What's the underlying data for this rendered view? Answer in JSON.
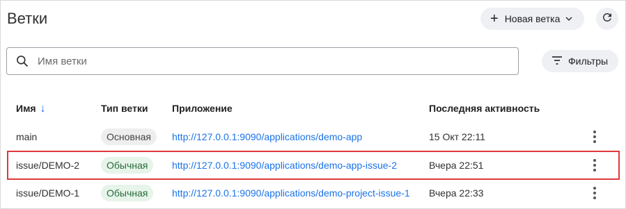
{
  "header": {
    "title": "Ветки",
    "new_branch_label": "Новая ветка",
    "new_branch_icon": "plus-icon",
    "refresh_icon": "refresh-icon"
  },
  "search": {
    "placeholder": "Имя ветки",
    "value": "",
    "icon": "search-icon"
  },
  "filters": {
    "label": "Фильтры",
    "icon": "filter-icon"
  },
  "table": {
    "columns": [
      "Имя",
      "Тип ветки",
      "Приложение",
      "Последняя активность"
    ],
    "sort_indicator": "↓",
    "rows": [
      {
        "name": "main",
        "type": "Основная",
        "app": "http://127.0.0.1:9090/applications/demo-app",
        "activity": "15 Окт 22:11"
      },
      {
        "name": "issue/DEMO-2",
        "type": "Обычная",
        "app": "http://127.0.0.1:9090/applications/demo-app-issue-2",
        "activity": "Вчера 22:51"
      },
      {
        "name": "issue/DEMO-1",
        "type": "Обычная",
        "app": "http://127.0.0.1:9090/applications/demo-project-issue-1",
        "activity": "Вчера 22:33"
      }
    ]
  },
  "colors": {
    "accent": "#1a73e8",
    "highlight": "#e0383b"
  }
}
